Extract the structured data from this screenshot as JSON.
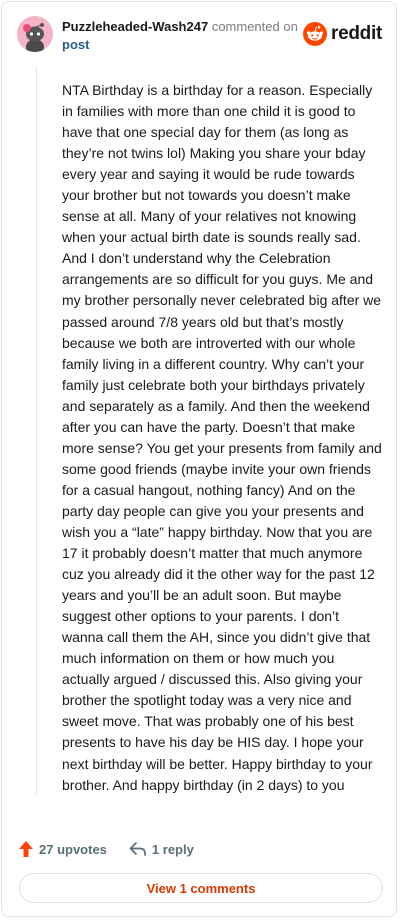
{
  "comment": {
    "username": "Puzzleheaded-Wash247",
    "action_text": "commented on",
    "post_link": "post",
    "body": "NTA Birthday is a birthday for a reason. Especially in families with more than one child it is good to have that one special day for them (as long as they’re not twins lol) Making you share your bday every year and saying it would be rude towards your brother but not towards you doesn’t make sense at all. Many of your relatives not knowing when your actual birth date is sounds really sad. And I don’t understand why the Celebration arrangements are so difficult for you guys. Me and my brother personally never celebrated big after we passed around 7/8 years old but that’s mostly because we both are introverted with our whole family living in a different country. Why can’t your family just celebrate both your birthdays privately and separately as a family. And then the weekend after you can have the party. Doesn’t that make more sense? You get your presents from family and some good friends (maybe invite your own friends for a casual hangout, nothing fancy) And on the party day people can give you your presents and wish you a “late” happy birthday. Now that you are 17 it probably doesn’t matter that much anymore cuz you already did it the other way for the past 12 years and you’ll be an adult soon. But maybe suggest other options to your parents. I don’t wanna call them the AH, since you didn’t give that much information on them or how much you actually argued / discussed this. Also giving your brother the spotlight today was a very nice and sweet move. That was probably one of his best presents to have his day be HIS day. I hope your next birthday will be better. Happy birthday to your brother. And happy birthday (in 2 days) to you",
    "upvotes": "27 upvotes",
    "replies": "1 reply",
    "view_comments": "View 1 comments"
  },
  "brand": {
    "logo_text": "reddit",
    "accent_color": "#ff4500",
    "link_color": "#d93a00"
  },
  "icons": {
    "avatar": "snoo-avatar-icon",
    "logo": "reddit-logo-icon",
    "upvote": "upvote-arrow-icon",
    "reply": "reply-arrow-icon"
  }
}
